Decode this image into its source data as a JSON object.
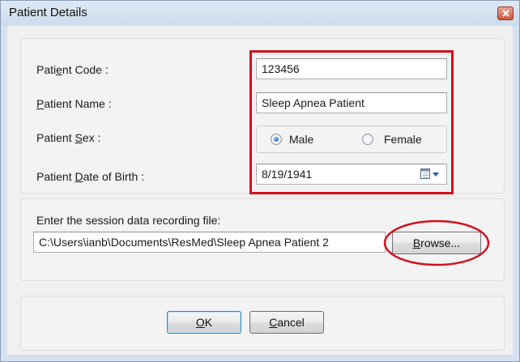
{
  "window": {
    "title": "Patient Details"
  },
  "fields": {
    "patient_code": {
      "label_pre": "Pati",
      "label_key": "e",
      "label_post": "nt Code :",
      "value": "123456"
    },
    "patient_name": {
      "label_key": "P",
      "label_post": "atient Name :",
      "value": "Sleep Apnea Patient"
    },
    "patient_sex": {
      "label_pre": "Patient ",
      "label_key": "S",
      "label_post": "ex :",
      "options": [
        "Male",
        "Female"
      ],
      "selected": "Male"
    },
    "patient_dob": {
      "label_pre": "Patient ",
      "label_key": "D",
      "label_post": "ate of Birth :",
      "value": "8/19/1941"
    }
  },
  "session": {
    "label": "Enter the session data recording file:",
    "path": "C:\\Users\\ianb\\Documents\\ResMed\\Sleep Apnea Patient  2",
    "browse_key": "B",
    "browse_post": "rowse..."
  },
  "buttons": {
    "ok_key": "O",
    "ok_post": "K",
    "cancel_key": "C",
    "cancel_post": "ancel"
  },
  "annotations": {
    "highlight_color": "#d1101f"
  }
}
